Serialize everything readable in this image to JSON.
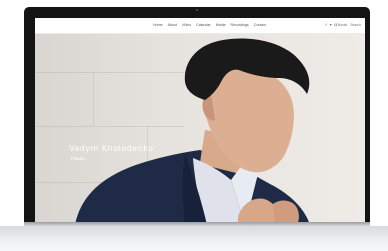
{
  "nav": {
    "items": [
      {
        "label": "Home"
      },
      {
        "label": "About"
      },
      {
        "label": "Video"
      },
      {
        "label": "Calendar"
      },
      {
        "label": "Media"
      },
      {
        "label": "Recordings"
      },
      {
        "label": "Contact"
      }
    ]
  },
  "social": {
    "icons": [
      "facebook-icon",
      "twitter-icon",
      "instagram-icon"
    ]
  },
  "header_links": [
    "Books",
    "Search"
  ],
  "hero": {
    "title": "Vadym Kholodenko",
    "subtitle": "Pianist"
  },
  "colors": {
    "monitor_frame": "#141414",
    "hero_wall": "#e6e2de",
    "jacket": "#1f2b46",
    "hair": "#1a1a1a",
    "shirt": "#dfe2ea",
    "text_light": "#ffffff"
  }
}
